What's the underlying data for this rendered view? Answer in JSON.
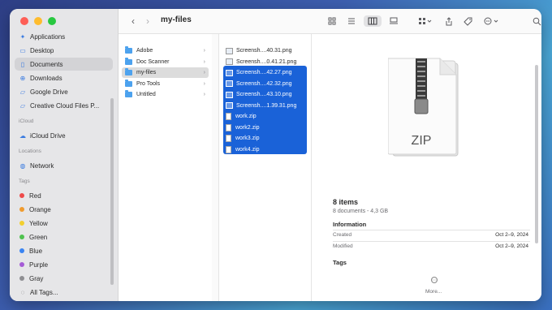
{
  "window": {
    "title": "my-files"
  },
  "colors": {
    "accent": "#1a62d8",
    "folder": "#4da2ee"
  },
  "sidebar": {
    "favorites": [
      {
        "label": "Applications",
        "icon": "applications-icon",
        "selected": false
      },
      {
        "label": "Desktop",
        "icon": "desktop-icon",
        "selected": false
      },
      {
        "label": "Documents",
        "icon": "document-icon",
        "selected": true
      },
      {
        "label": "Downloads",
        "icon": "download-icon",
        "selected": false
      },
      {
        "label": "Google Drive",
        "icon": "folder-icon",
        "selected": false
      },
      {
        "label": "Creative Cloud Files P...",
        "icon": "folder-icon",
        "selected": false
      }
    ],
    "icloud_header": "iCloud",
    "icloud": [
      {
        "label": "iCloud Drive",
        "icon": "cloud-icon"
      }
    ],
    "locations_header": "Locations",
    "locations": [
      {
        "label": "Network",
        "icon": "network-icon"
      }
    ],
    "tags_header": "Tags",
    "tags": [
      {
        "label": "Red",
        "color": "#ee4a4a"
      },
      {
        "label": "Orange",
        "color": "#f09b2e"
      },
      {
        "label": "Yellow",
        "color": "#f2cf2f"
      },
      {
        "label": "Green",
        "color": "#4fc24f"
      },
      {
        "label": "Blue",
        "color": "#3a84f2"
      },
      {
        "label": "Purple",
        "color": "#a55bd6"
      },
      {
        "label": "Gray",
        "color": "#8e8e92"
      },
      {
        "label": "All Tags...",
        "color": ""
      }
    ]
  },
  "column1": [
    {
      "label": "Adobe",
      "selected": false
    },
    {
      "label": "Doc Scanner",
      "selected": false
    },
    {
      "label": "my-files",
      "selected": true
    },
    {
      "label": "Pro Tools",
      "selected": false
    },
    {
      "label": "Untitled",
      "selected": false
    }
  ],
  "column2": [
    {
      "label": "Screensh....40.31.png",
      "selected": false,
      "kind": "png"
    },
    {
      "label": "Screensh....0.41.21.png",
      "selected": false,
      "kind": "png"
    },
    {
      "label": "Screensh....42.27.png",
      "selected": true,
      "kind": "png"
    },
    {
      "label": "Screensh....42.32.png",
      "selected": true,
      "kind": "png"
    },
    {
      "label": "Screensh....43.10.png",
      "selected": true,
      "kind": "png"
    },
    {
      "label": "Screensh....1.39.31.png",
      "selected": true,
      "kind": "png"
    },
    {
      "label": "work.zip",
      "selected": true,
      "kind": "zip"
    },
    {
      "label": "work2.zip",
      "selected": true,
      "kind": "zip"
    },
    {
      "label": "work3.zip",
      "selected": true,
      "kind": "zip"
    },
    {
      "label": "work4.zip",
      "selected": true,
      "kind": "zip"
    }
  ],
  "preview": {
    "icon_label": "ZIP",
    "count": "8 items",
    "summary": "8 documents - 4,3 GB",
    "info_header": "Information",
    "created_label": "Created",
    "created_value": "Oct 2–9, 2024",
    "modified_label": "Modified",
    "modified_value": "Oct 2–9, 2024",
    "tags_header": "Tags",
    "more_label": "More..."
  }
}
